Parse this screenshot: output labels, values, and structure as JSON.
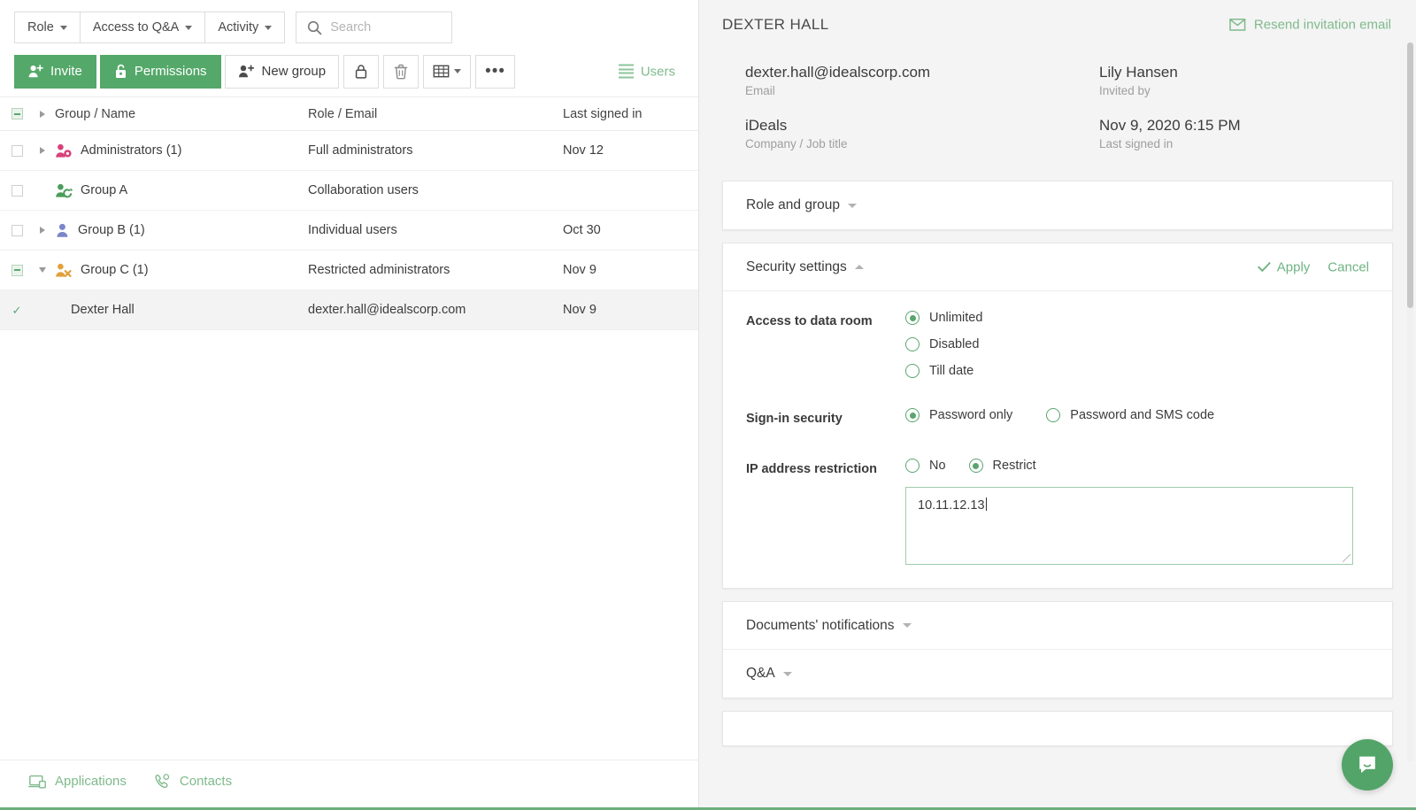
{
  "left": {
    "filters": [
      {
        "label": "Role"
      },
      {
        "label": "Access to Q&A"
      },
      {
        "label": "Activity"
      }
    ],
    "search": {
      "placeholder": "Search",
      "value": ""
    },
    "toolbar": {
      "invite_label": "Invite",
      "permissions_label": "Permissions",
      "new_group_label": "New group",
      "lock_label": "",
      "delete_label": "",
      "columns_label": "",
      "more_label": "•••",
      "users_label": "Users"
    },
    "table": {
      "headers": {
        "name": "Group / Name",
        "role": "Role / Email",
        "signed": "Last signed in"
      },
      "rows": [
        {
          "name": "Administrators (1)",
          "role": "Full administrators",
          "signed": "Nov 12",
          "check": "empty",
          "expander": "right",
          "icon": "group-admin-icon",
          "icon_color": "#d6417b",
          "indent": 0,
          "selected": false
        },
        {
          "name": "Group A",
          "role": "Collaboration users",
          "signed": "",
          "check": "empty",
          "expander": "none",
          "icon": "group-collaboration-icon",
          "icon_color": "#4a9d5b",
          "indent": 0,
          "selected": false
        },
        {
          "name": "Group B (1)",
          "role": "Individual users",
          "signed": "Oct 30",
          "check": "empty",
          "expander": "right",
          "icon": "group-individual-icon",
          "icon_color": "#7b85c9",
          "indent": 0,
          "selected": false
        },
        {
          "name": "Group C (1)",
          "role": "Restricted administrators",
          "signed": "Nov 9",
          "check": "dash",
          "expander": "down",
          "icon": "group-restricted-icon",
          "icon_color": "#e0a13c",
          "indent": 0,
          "selected": false
        },
        {
          "name": "Dexter Hall",
          "role": "dexter.hall@idealscorp.com",
          "signed": "Nov 9",
          "check": "checked",
          "expander": "none",
          "icon": "none",
          "icon_color": "",
          "indent": 1,
          "selected": true
        }
      ]
    },
    "footer": {
      "applications": "Applications",
      "contacts": "Contacts"
    }
  },
  "right": {
    "title": "DEXTER HALL",
    "resend_label": "Resend invitation email",
    "info": [
      {
        "value": "dexter.hall@idealscorp.com",
        "label": "Email"
      },
      {
        "value": "Lily Hansen",
        "label": "Invited by"
      },
      {
        "value": "iDeals",
        "label": "Company / Job title"
      },
      {
        "value": "Nov 9, 2020 6:15 PM",
        "label": "Last signed in"
      }
    ],
    "sections": {
      "role_and_group": {
        "title": "Role and group",
        "expanded": false
      },
      "security": {
        "title": "Security settings",
        "expanded": true,
        "apply_label": "Apply",
        "cancel_label": "Cancel",
        "fields": {
          "access": {
            "label": "Access to data room",
            "options": [
              "Unlimited",
              "Disabled",
              "Till date"
            ],
            "selected": "Unlimited"
          },
          "signin": {
            "label": "Sign-in security",
            "options": [
              "Password only",
              "Password and SMS code"
            ],
            "selected": "Password only"
          },
          "ip": {
            "label": "IP address restriction",
            "options": [
              "No",
              "Restrict"
            ],
            "selected": "Restrict",
            "value": "10.11.12.13"
          }
        }
      },
      "documents_notifications": {
        "title": "Documents' notifications",
        "expanded": false
      },
      "qa": {
        "title": "Q&A",
        "expanded": false
      }
    }
  },
  "colors": {
    "accent_green": "#54a869",
    "link_green": "#7fba8c",
    "panel_bg": "#f4f4f4",
    "selected_row": "#f3f3f3"
  }
}
